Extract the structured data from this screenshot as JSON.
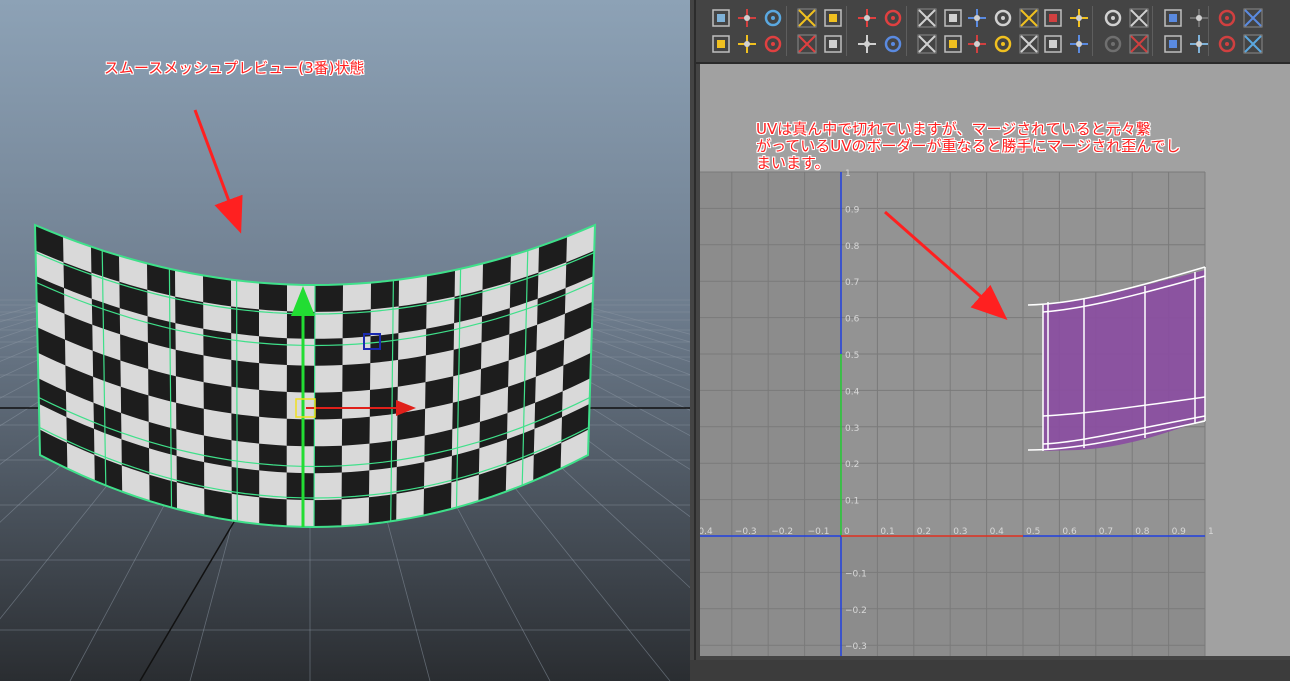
{
  "viewport": {
    "annotation": "スムースメッシュプレビュー(3番)状態",
    "mesh_color": "#3fe08a",
    "manipulator": {
      "y_color": "#22dd33",
      "x_color": "#e0201a",
      "center_color": "#f0e020"
    }
  },
  "uv_editor": {
    "annotation_lines": [
      "UVは真ん中で切れていますが、マージされていると元々繋",
      "がっているUVのボーダーが重なると勝手にマージされ歪んでし",
      "まいます。"
    ],
    "toolbar_icons": [
      "uv-lattice-icon",
      "uv-move-icon",
      "uv-select-icon",
      "flip-u-icon",
      "flip-v-icon",
      "rotate-ccw-icon",
      "rotate-cw-icon",
      "cut-uv-icon",
      "sew-uv-icon",
      "move-sew-icon",
      "layout-uv-icon",
      "grid-uv-icon",
      "align-left-icon",
      "align-right-icon",
      "align-top-icon",
      "align-bottom-icon",
      "unfold-icon",
      "relax-icon",
      "isolate-icon",
      "checker-icon",
      "grid-toggle-icon",
      "snap-icon",
      "shaded-uv-icon",
      "texture-borders-icon",
      "uv-distortion-icon",
      "image-display-icon",
      "dim-image-icon",
      "filter-icon",
      "rgb-channels-icon",
      "exposure-icon"
    ],
    "axis": {
      "x_ticks": [
        "0.4",
        "−0.3",
        "−0.2",
        "−0.1",
        "0",
        "0.1",
        "0.2",
        "0.3",
        "0.4",
        "0.5",
        "0.6",
        "0.7",
        "0.8",
        "0.9",
        "1"
      ],
      "y_ticks": [
        "1",
        "0.9",
        "0.8",
        "0.7",
        "0.6",
        "0.5",
        "0.4",
        "0.3",
        "0.2",
        "0.1",
        "−0.1",
        "−0.2",
        "−0.3"
      ],
      "u_axis_color": "#e03020",
      "v_axis_color": "#2040e0",
      "shell_color": "#8a4fa0"
    }
  }
}
